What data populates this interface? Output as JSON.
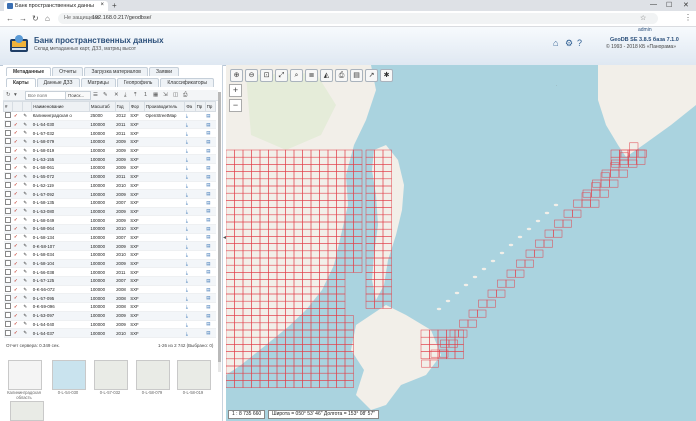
{
  "browser": {
    "tab_title": "Банк пространственных данны",
    "tab_close": "×",
    "new_tab": "+",
    "security": "Не защищено",
    "url": "192.168.0.217/geodbse/",
    "win_min": "—",
    "win_max": "☐",
    "win_close": "✕"
  },
  "app": {
    "title": "Банк пространственных данных",
    "subtitle": "Склад метаданных карт, ДЗЗ, матриц высот",
    "version": "GeoDB SE 3.8.5 база 7.1.0",
    "copyright": "© 1993 - 2018 КБ «Панорама»",
    "user": "admin"
  },
  "tabs_primary": [
    "Метаданные",
    "Отчеты",
    "Загрузка материалов",
    "Заявки"
  ],
  "tabs_secondary": [
    "Карты",
    "Данные ДЗЗ",
    "Матрицы",
    "Геопрофиль",
    "Классификаторы"
  ],
  "toolbar": {
    "search_placeholder": "Все поля",
    "search_button": "Поиск...",
    "page_num": "1"
  },
  "table": {
    "headers": [
      "#",
      "",
      "",
      "Наименование",
      "Масштаб",
      "Год",
      "Фор",
      "Производитель",
      "Фа",
      "Пр",
      "Пр"
    ],
    "rows": [
      {
        "name": "Калининградская о",
        "scale": "25000",
        "year": "2012",
        "fmt": "SXF",
        "maker": "OpenStreetMap"
      },
      {
        "name": "0-L-54-030",
        "scale": "100000",
        "year": "2011",
        "fmt": "SXF",
        "maker": ""
      },
      {
        "name": "0-L-57-032",
        "scale": "100000",
        "year": "2011",
        "fmt": "SXF",
        "maker": ""
      },
      {
        "name": "0-L-58-079",
        "scale": "100000",
        "year": "2009",
        "fmt": "SXF",
        "maker": ""
      },
      {
        "name": "0-L-58-019",
        "scale": "100000",
        "year": "2009",
        "fmt": "SXF",
        "maker": ""
      },
      {
        "name": "0-L-53-155",
        "scale": "100000",
        "year": "2009",
        "fmt": "SXF",
        "maker": ""
      },
      {
        "name": "0-L-58-061",
        "scale": "100000",
        "year": "2009",
        "fmt": "SXF",
        "maker": ""
      },
      {
        "name": "0-L-55-072",
        "scale": "100000",
        "year": "2011",
        "fmt": "SXF",
        "maker": ""
      },
      {
        "name": "0-L-52-119",
        "year": "2010",
        "scale": "100000",
        "fmt": "SXF",
        "maker": ""
      },
      {
        "name": "0-L-57-092",
        "scale": "100000",
        "year": "2009",
        "fmt": "SXF",
        "maker": ""
      },
      {
        "name": "0-L-58-135",
        "scale": "100000",
        "year": "2007",
        "fmt": "SXF",
        "maker": ""
      },
      {
        "name": "0-L-53-080",
        "scale": "100000",
        "year": "2009",
        "fmt": "SXF",
        "maker": ""
      },
      {
        "name": "0-L-58-049",
        "scale": "100000",
        "year": "2009",
        "fmt": "SXF",
        "maker": ""
      },
      {
        "name": "0-L-58-064",
        "scale": "100000",
        "year": "2010",
        "fmt": "SXF",
        "maker": ""
      },
      {
        "name": "0-L-58-134",
        "scale": "100000",
        "year": "2007",
        "fmt": "SXF",
        "maker": ""
      },
      {
        "name": "0-K-58-107",
        "scale": "100000",
        "year": "2009",
        "fmt": "SXF",
        "maker": ""
      },
      {
        "name": "0-L-58-034",
        "scale": "100000",
        "year": "2010",
        "fmt": "SXF",
        "maker": ""
      },
      {
        "name": "0-L-58-104",
        "scale": "100000",
        "year": "2009",
        "fmt": "SXF",
        "maker": ""
      },
      {
        "name": "0-L-56-038",
        "scale": "100000",
        "year": "2011",
        "fmt": "SXF",
        "maker": ""
      },
      {
        "name": "0-L-57-125",
        "scale": "100000",
        "year": "2007",
        "fmt": "SXF",
        "maker": ""
      },
      {
        "name": "0-K-56-072",
        "scale": "100000",
        "year": "2008",
        "fmt": "SXF",
        "maker": ""
      },
      {
        "name": "0-L-57-095",
        "scale": "100000",
        "year": "2008",
        "fmt": "SXF",
        "maker": ""
      },
      {
        "name": "0-K-59-096",
        "scale": "100000",
        "year": "2008",
        "fmt": "SXF",
        "maker": ""
      },
      {
        "name": "0-L-53-097",
        "scale": "100000",
        "year": "2009",
        "fmt": "SXF",
        "maker": ""
      },
      {
        "name": "0-L-54-040",
        "scale": "100000",
        "year": "2009",
        "fmt": "SXF",
        "maker": ""
      },
      {
        "name": "0-L-54-037",
        "scale": "100000",
        "year": "2010",
        "fmt": "SXF",
        "maker": ""
      }
    ]
  },
  "status": {
    "left": "Отчет сервера: 0.349 сек.",
    "right": "1-26 из 2 742 (Выбрано: 0)"
  },
  "thumbs": [
    "Калининградская область",
    "0-L-54-030",
    "0-L-57-032",
    "0-L-58-079",
    "0-L-58-019",
    ""
  ],
  "map": {
    "scale_text": "1 : 8 735 660",
    "coords_text": "Широта = 050° 53' 46\"  Долгота = 153° 08' 57\""
  },
  "colors": {
    "grid_red": "#e2404a",
    "sea": "#aad3df",
    "land": "#f2efe9",
    "header_blue": "#2b4f7a"
  }
}
